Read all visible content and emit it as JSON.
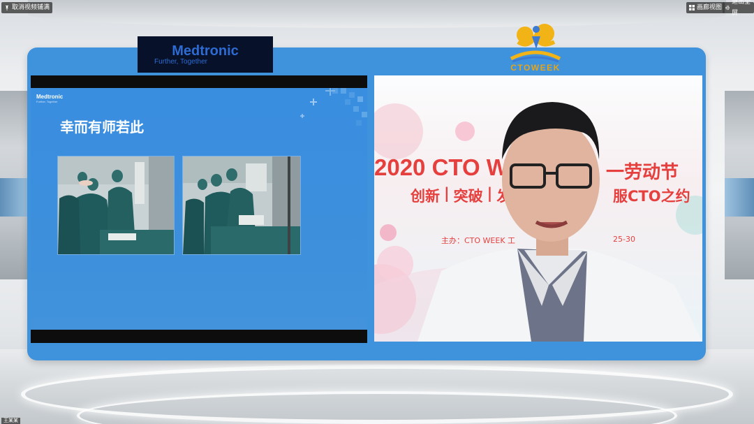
{
  "toolbar": {
    "cancel_label": "取消视频铺满",
    "pip_label": "画廊视图",
    "exit_label": "退出全屏"
  },
  "header": {
    "sponsor_brand": "Medtronic",
    "sponsor_tagline": "Further, Together",
    "event_logo_text": "CTOWEEK"
  },
  "slide": {
    "brand": "Medtronic",
    "brand_sub": "Further, Together",
    "title": "幸而有师若此"
  },
  "camera": {
    "banner_line1_left": "2020 CTO W",
    "banner_line1_right": "一劳动节",
    "banner_line2_parts": [
      "创新",
      "突破",
      "发"
    ],
    "banner_line2_right": "服CTO之约",
    "banner_line3_left": "主办：CTO WEEK 工",
    "banner_line3_right": "25-30"
  },
  "footer": {
    "user_label": "王某某"
  },
  "colors": {
    "panel_blue": "#3f92dc",
    "brand_blue": "#2d6bd3",
    "banner_red": "#e5403e",
    "logo_gold": "#e8a417"
  }
}
